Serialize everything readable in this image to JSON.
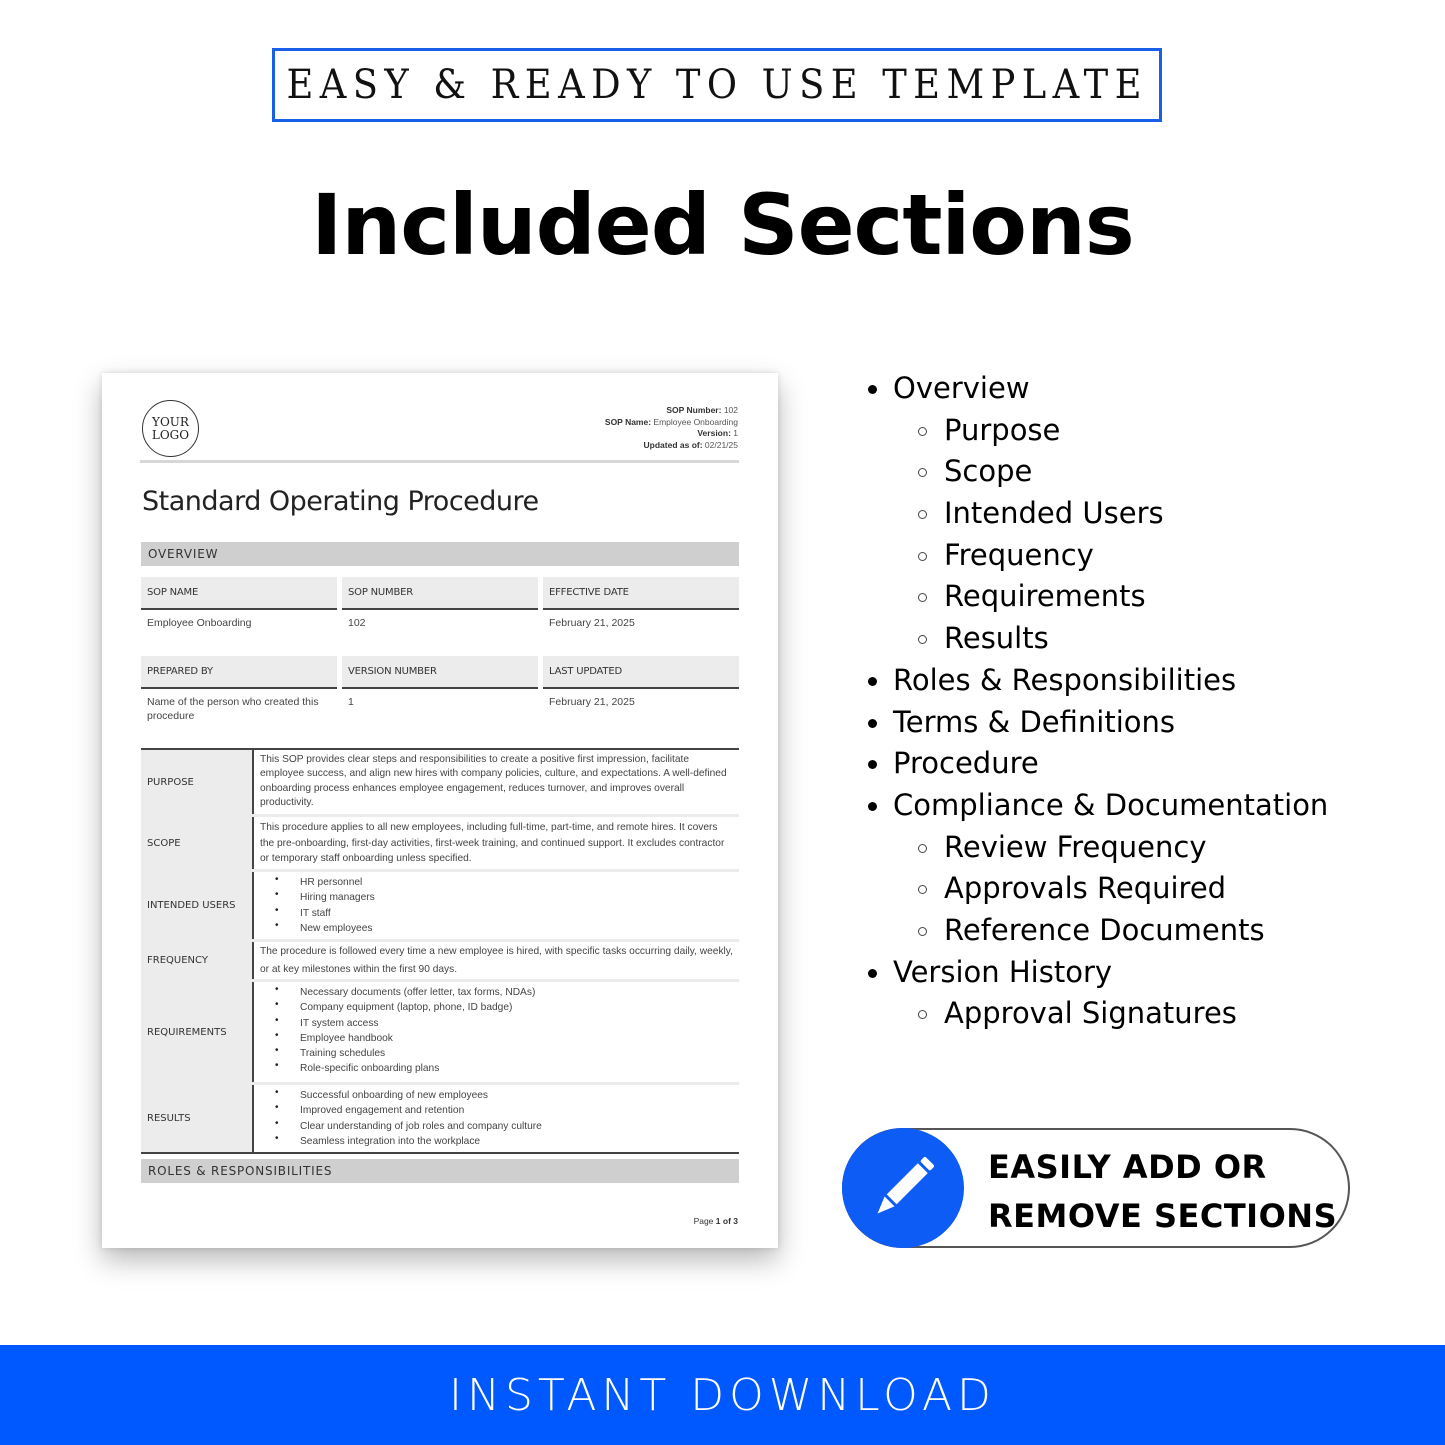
{
  "header": {
    "badge_text": "EASY & READY TO USE TEMPLATE",
    "title": "Included Sections"
  },
  "document": {
    "logo_line1": "YOUR",
    "logo_line2": "LOGO",
    "meta": [
      {
        "label": "SOP Number:",
        "value": " 102"
      },
      {
        "label": "SOP Name:",
        "value": " Employee Onboarding"
      },
      {
        "label": "Version:",
        "value": " 1"
      },
      {
        "label": "Updated as of:",
        "value": " 02/21/25"
      }
    ],
    "title": "Standard Operating Procedure",
    "overview_heading": "OVERVIEW",
    "info_row1": {
      "headers": [
        "SOP NAME",
        "SOP NUMBER",
        "EFFECTIVE DATE"
      ],
      "values": [
        "Employee Onboarding",
        "102",
        "February 21, 2025"
      ]
    },
    "info_row2": {
      "headers": [
        "PREPARED BY",
        "VERSION NUMBER",
        "LAST UPDATED"
      ],
      "values": [
        "Name of the person who created this procedure",
        "1",
        "February 21, 2025"
      ]
    },
    "details": {
      "purpose": {
        "label": "PURPOSE",
        "text": "This SOP provides clear steps and responsibilities to create a positive first impression, facilitate employee success, and align new hires with company policies, culture, and expectations. A well-defined onboarding process enhances employee engagement, reduces turnover, and improves overall productivity."
      },
      "scope": {
        "label": "SCOPE",
        "text": "This procedure applies to all new employees, including full-time, part-time, and remote hires. It covers the pre-onboarding, first-day activities, first-week training, and continued support. It excludes contractor or temporary staff onboarding unless specified."
      },
      "intended_users": {
        "label": "INTENDED USERS",
        "items": [
          "HR personnel",
          "Hiring managers",
          "IT staff",
          "New employees"
        ]
      },
      "frequency": {
        "label": "FREQUENCY",
        "text": "The procedure is followed every time a new employee is hired, with specific tasks occurring daily, weekly, or at key milestones within the first 90 days."
      },
      "requirements": {
        "label": "REQUIREMENTS",
        "items": [
          "Necessary documents (offer letter, tax forms, NDAs)",
          "Company equipment (laptop, phone, ID badge)",
          "IT system access",
          "Employee handbook",
          "Training schedules",
          "Role-specific onboarding plans"
        ]
      },
      "results": {
        "label": "RESULTS",
        "items": [
          "Successful onboarding of new employees",
          "Improved engagement and retention",
          "Clear understanding of job roles and company culture",
          "Seamless integration into the workplace"
        ]
      }
    },
    "roles_heading": "ROLES & RESPONSIBILITIES",
    "page_prefix": "Page ",
    "page_current": "1",
    "page_of": " of ",
    "page_total": "3"
  },
  "sections": [
    {
      "label": "Overview",
      "level": 1
    },
    {
      "label": "Purpose",
      "level": 2
    },
    {
      "label": "Scope",
      "level": 2
    },
    {
      "label": "Intended Users",
      "level": 2
    },
    {
      "label": "Frequency",
      "level": 2
    },
    {
      "label": "Requirements",
      "level": 2
    },
    {
      "label": "Results",
      "level": 2
    },
    {
      "label": "Roles & Responsibilities",
      "level": 1
    },
    {
      "label": "Terms & Definitions",
      "level": 1
    },
    {
      "label": "Procedure",
      "level": 1
    },
    {
      "label": "Compliance & Documentation",
      "level": 1
    },
    {
      "label": "Review Frequency",
      "level": 2
    },
    {
      "label": "Approvals Required",
      "level": 2
    },
    {
      "label": "Reference Documents",
      "level": 2
    },
    {
      "label": "Version History",
      "level": 1
    },
    {
      "label": "Approval Signatures",
      "level": 2
    }
  ],
  "feature_pill": {
    "icon": "pencil-icon",
    "line1": "EASILY ADD OR",
    "line2": "REMOVE SECTIONS"
  },
  "footer": {
    "banner_text": "INSTANT DOWNLOAD"
  },
  "colors": {
    "accent_blue": "#0059ff",
    "badge_border": "#1a5fe8",
    "section_bar_gray": "#d0cfd0",
    "cell_gray": "#ececec"
  }
}
